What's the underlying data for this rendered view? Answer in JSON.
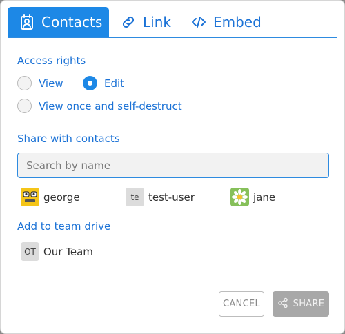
{
  "tabs": [
    {
      "label": "Contacts",
      "icon": "contact-card-icon",
      "active": true
    },
    {
      "label": "Link",
      "icon": "link-icon",
      "active": false
    },
    {
      "label": "Embed",
      "icon": "code-icon",
      "active": false
    }
  ],
  "access": {
    "label": "Access rights",
    "options": [
      {
        "label": "View",
        "checked": false
      },
      {
        "label": "Edit",
        "checked": true
      },
      {
        "label": "View once and self-destruct",
        "checked": false
      }
    ]
  },
  "share": {
    "label": "Share with contacts",
    "search_placeholder": "Search by name",
    "contacts": [
      {
        "name": "george",
        "avatar": "robot-face-icon"
      },
      {
        "name": "test-user",
        "avatar_initials": "te"
      },
      {
        "name": "jane",
        "avatar": "daisy-flower-icon"
      }
    ]
  },
  "team": {
    "label": "Add to team drive",
    "items": [
      {
        "name": "Our Team",
        "avatar_initials": "OT"
      }
    ]
  },
  "buttons": {
    "cancel": "CANCEL",
    "share": "SHARE"
  },
  "colors": {
    "accent": "#1d88e6",
    "link_text": "#1b72d6",
    "share_button": "#a8a8a8"
  }
}
